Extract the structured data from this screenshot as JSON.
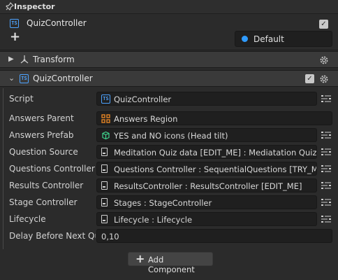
{
  "window": {
    "title": "Inspector"
  },
  "object": {
    "name": "QuizController",
    "enabled_mark": "✓",
    "add_symbol": "+",
    "layer": "Default",
    "layer_color": "#2f9bff"
  },
  "components": {
    "transform": {
      "label": "Transform"
    },
    "quiz": {
      "label": "QuizController",
      "enabled_mark": "✓"
    }
  },
  "properties": [
    {
      "label": "Script",
      "value": "QuizController",
      "icon": "typescript-icon"
    },
    {
      "label": "Answers Parent",
      "value": "Answers Region",
      "icon": "hierarchy-icon"
    },
    {
      "label": "Answers Prefab",
      "value": "YES and NO icons (Head tilt)",
      "icon": "cube-icon"
    },
    {
      "label": "Question Source",
      "value": "Meditation Quiz data [EDIT_ME] : Mediatation Quiz Da",
      "icon": "document-icon"
    },
    {
      "label": "Questions Controller",
      "value": "Questions Controller : SequentialQuestions [TRY_ME]",
      "icon": "document-icon"
    },
    {
      "label": "Results Controller",
      "value": "ResultsController : ResultsController [EDIT_ME]",
      "icon": "document-icon"
    },
    {
      "label": "Stage Controller",
      "value": "Stages : StageController",
      "icon": "document-icon"
    },
    {
      "label": "Lifecycle",
      "value": "Lifecycle : Lifecycle",
      "icon": "document-icon"
    },
    {
      "label": "Delay Before Next Qu",
      "value": "0,10",
      "icon": ""
    }
  ],
  "add_component": {
    "symbol": "+",
    "label": "Add Component"
  },
  "colors": {
    "accent": "#4da3ff",
    "panel": "#2b2b2b",
    "field": "#1f1f1f",
    "component_header": "#3a3a3a"
  }
}
